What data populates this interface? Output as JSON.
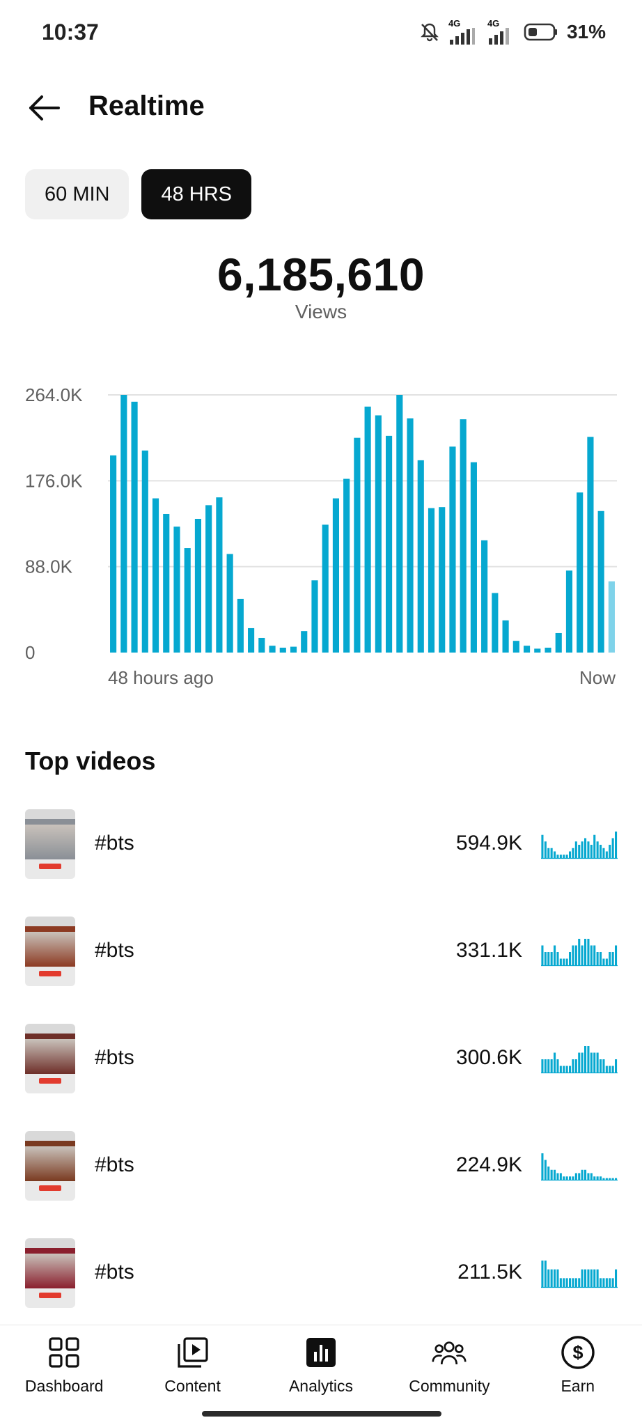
{
  "status_bar": {
    "time": "10:37",
    "network_1": "4G",
    "network_2": "4G",
    "battery": "31%"
  },
  "header": {
    "title": "Realtime",
    "back_icon": "arrow-left-icon"
  },
  "range_toggle": {
    "options": [
      "60 MIN",
      "48 HRS"
    ],
    "selected": "48 HRS"
  },
  "metric": {
    "value": "6,185,610",
    "label": "Views"
  },
  "chart_data": {
    "type": "bar",
    "y_ticks": [
      "264.0K",
      "176.0K",
      "88.0K",
      "0"
    ],
    "ylim": [
      0,
      264000
    ],
    "x_start_label": "48 hours ago",
    "x_end_label": "Now",
    "bar_color": "#06a8d0",
    "last_bar_color": "#7fd3ea",
    "grid": true,
    "values": [
      202000,
      264000,
      257000,
      207000,
      158000,
      142000,
      129000,
      107000,
      137000,
      151000,
      159000,
      101000,
      55000,
      25000,
      15000,
      7000,
      5000,
      6000,
      22000,
      74000,
      131000,
      158000,
      178000,
      220000,
      252000,
      243000,
      222000,
      264000,
      240000,
      197000,
      148000,
      149000,
      211000,
      239000,
      195000,
      115000,
      61000,
      33000,
      12000,
      7000,
      4000,
      5000,
      20000,
      84000,
      164000,
      221000,
      145000,
      73000
    ]
  },
  "top_videos": {
    "title": "Top videos",
    "items": [
      {
        "title": "#bts",
        "views": "594.9K",
        "thumb_color": "#8a8f96",
        "spark": [
          7,
          5,
          3,
          3,
          2,
          1,
          1,
          1,
          1,
          2,
          3,
          5,
          4,
          5,
          6,
          5,
          4,
          7,
          5,
          4,
          3,
          2,
          4,
          6,
          8
        ]
      },
      {
        "title": "#bts",
        "views": "331.1K",
        "thumb_color": "#8c3a22",
        "spark": [
          3,
          2,
          2,
          2,
          3,
          2,
          1,
          1,
          1,
          2,
          3,
          3,
          4,
          3,
          4,
          4,
          3,
          3,
          2,
          2,
          1,
          1,
          2,
          2,
          3
        ]
      },
      {
        "title": "#bts",
        "views": "300.6K",
        "thumb_color": "#6e2f29",
        "spark": [
          2,
          2,
          2,
          2,
          3,
          2,
          1,
          1,
          1,
          1,
          2,
          2,
          3,
          3,
          4,
          4,
          3,
          3,
          3,
          2,
          2,
          1,
          1,
          1,
          2
        ]
      },
      {
        "title": "#bts",
        "views": "224.9K",
        "thumb_color": "#7a3a20",
        "spark": [
          8,
          6,
          4,
          3,
          3,
          2,
          2,
          1,
          1,
          1,
          1,
          2,
          2,
          3,
          3,
          2,
          2,
          1,
          1,
          1,
          0.5,
          0.5,
          0.5,
          0.5,
          0.5
        ]
      },
      {
        "title": "#bts",
        "views": "211.5K",
        "thumb_color": "#8a1f2d",
        "spark": [
          3,
          3,
          2,
          2,
          2,
          2,
          1,
          1,
          1,
          1,
          1,
          1,
          1,
          2,
          2,
          2,
          2,
          2,
          2,
          1,
          1,
          1,
          1,
          1,
          2
        ]
      }
    ]
  },
  "bottom_nav": {
    "items": [
      {
        "label": "Dashboard",
        "icon": "dashboard-icon"
      },
      {
        "label": "Content",
        "icon": "content-icon"
      },
      {
        "label": "Analytics",
        "icon": "analytics-icon"
      },
      {
        "label": "Community",
        "icon": "community-icon"
      },
      {
        "label": "Earn",
        "icon": "earn-icon"
      }
    ],
    "selected": "Analytics"
  }
}
